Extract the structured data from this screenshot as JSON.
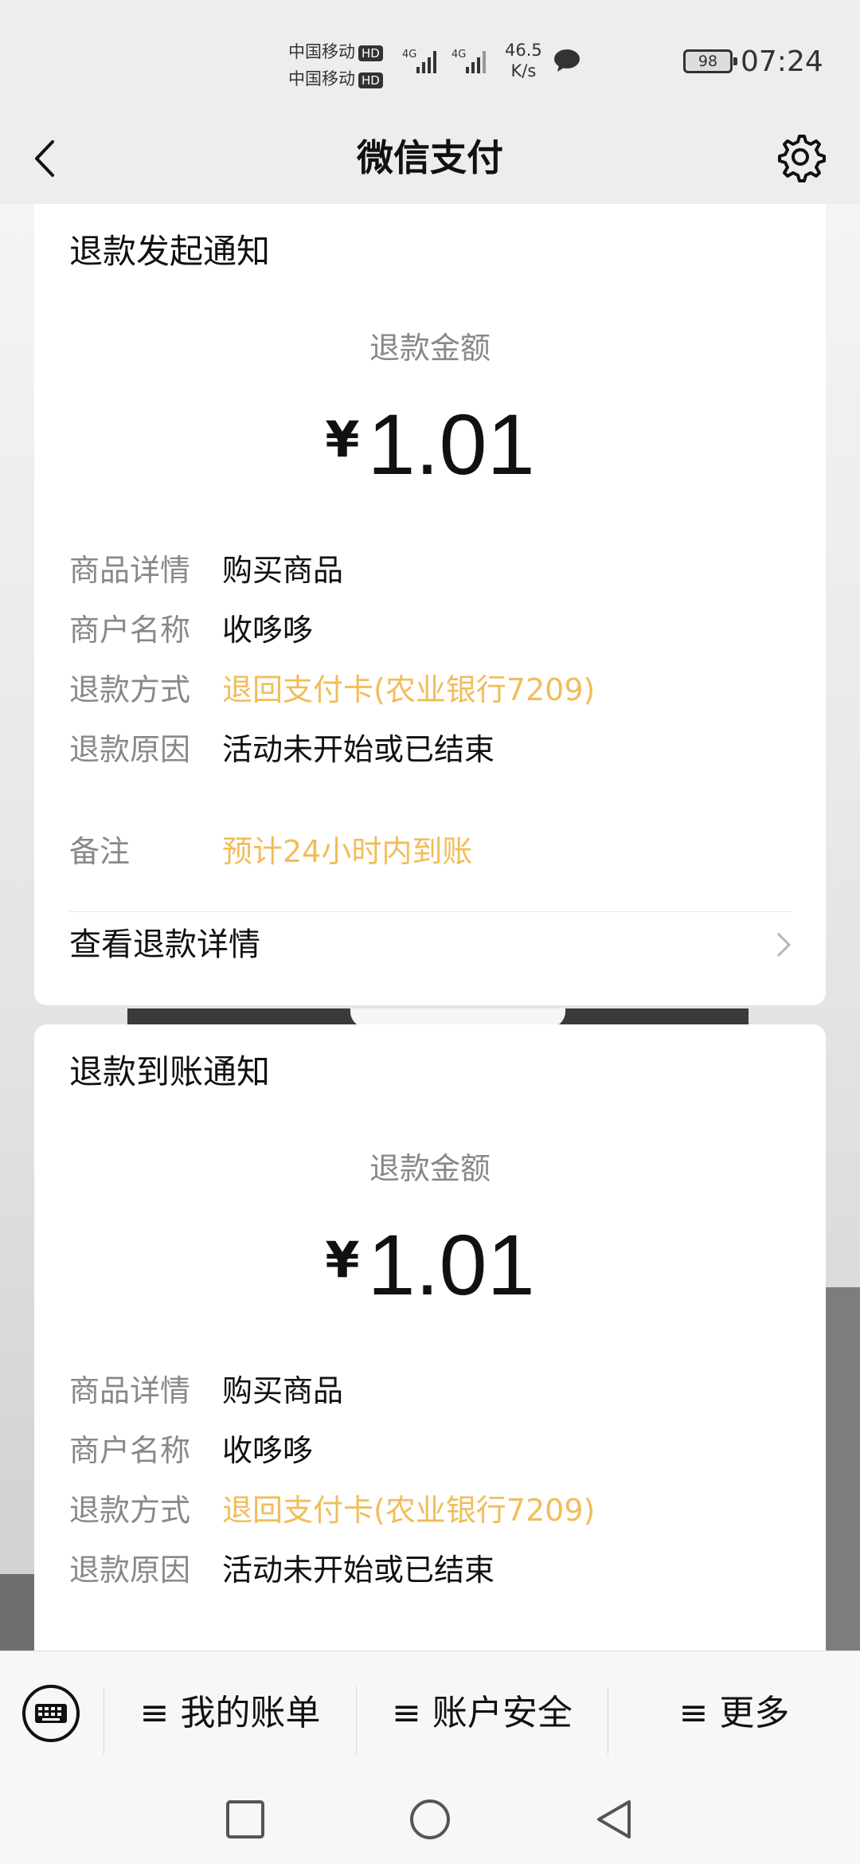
{
  "status_bar": {
    "carrier1": "中国移动",
    "carrier2": "中国移动",
    "hd": "HD",
    "net_type": "4G",
    "speed_value": "46.5",
    "speed_unit": "K/s",
    "battery": "98",
    "time": "07:24"
  },
  "header": {
    "title": "微信支付"
  },
  "cards": [
    {
      "title": "退款发起通知",
      "amount_label": "退款金额",
      "currency": "¥",
      "amount": "1.01",
      "rows": [
        {
          "key": "商品详情",
          "value": "购买商品"
        },
        {
          "key": "商户名称",
          "value": "收哆哆"
        },
        {
          "key": "退款方式",
          "value": "退回支付卡(农业银行7209)"
        },
        {
          "key": "退款原因",
          "value": "活动未开始或已结束"
        }
      ],
      "note_key": "备注",
      "note_value": "预计24小时内到账",
      "detail_link": "查看退款详情"
    },
    {
      "title": "退款到账通知",
      "amount_label": "退款金额",
      "currency": "¥",
      "amount": "1.01",
      "rows": [
        {
          "key": "商品详情",
          "value": "购买商品"
        },
        {
          "key": "商户名称",
          "value": "收哆哆"
        },
        {
          "key": "退款方式",
          "value": "退回支付卡(农业银行7209)"
        },
        {
          "key": "退款原因",
          "value": "活动未开始或已结束"
        }
      ]
    }
  ],
  "bottom_menu": {
    "items": [
      "≡ 我的账单",
      "≡ 账户安全",
      "≡ 更多"
    ]
  },
  "colors": {
    "accent_orange": "#f1bd5a",
    "label_gray": "#888888",
    "background": "#ededed"
  },
  "icons": [
    "back-chevron-icon",
    "gear-icon",
    "keyboard-icon",
    "chevron-right-icon",
    "square-recent-icon",
    "circle-home-icon",
    "triangle-back-icon",
    "message-icon",
    "signal-icon",
    "battery-icon"
  ]
}
